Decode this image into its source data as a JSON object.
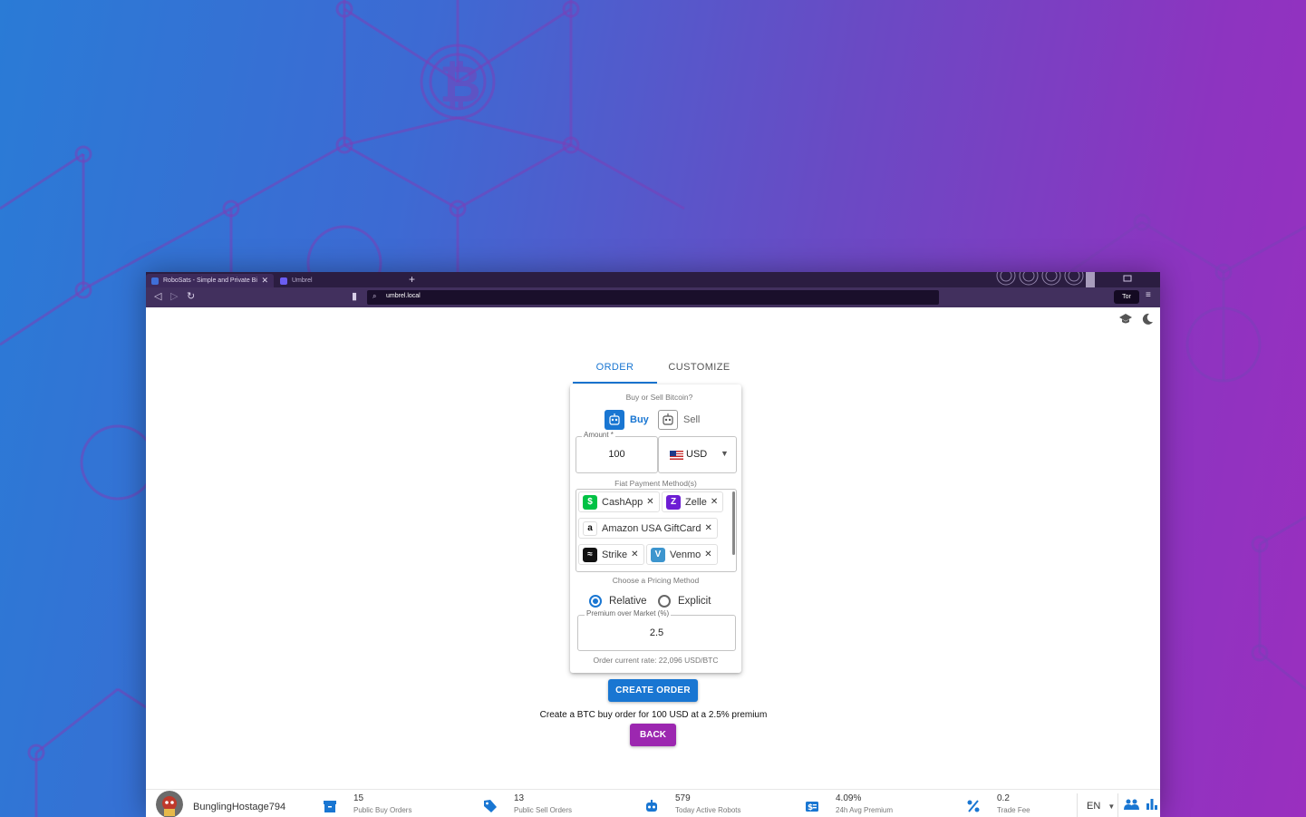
{
  "browser": {
    "tabs": [
      {
        "title": "RoboSats - Simple and Private Bi"
      },
      {
        "title": "Umbrel"
      }
    ],
    "url": "umbrel.local",
    "tor_label": "Tor"
  },
  "app": {
    "tabs": {
      "order": "ORDER",
      "customize": "CUSTOMIZE"
    },
    "form": {
      "buy_sell_label": "Buy or Sell Bitcoin?",
      "buy_label": "Buy",
      "sell_label": "Sell",
      "amount_label": "Amount *",
      "amount_value": "100",
      "currency_value": "USD",
      "payment_label": "Fiat Payment Method(s)",
      "payment_methods": [
        "CashApp",
        "Zelle",
        "Amazon USA GiftCard",
        "Strike",
        "Venmo"
      ],
      "pricing_label": "Choose a Pricing Method",
      "pricing_options": [
        "Relative",
        "Explicit"
      ],
      "pricing_selected": "Relative",
      "premium_label": "Premium over Market (%)",
      "premium_value": "2.5",
      "rate_text": "Order current rate: 22,096 USD/BTC"
    },
    "create_button": "CREATE ORDER",
    "summary_text": "Create a BTC buy order for 100 USD at a 2.5% premium",
    "back_button": "BACK"
  },
  "bottom_bar": {
    "nickname": "BunglingHostage794",
    "stats": [
      {
        "value": "15",
        "label": "Public Buy Orders",
        "icon": "inventory-icon"
      },
      {
        "value": "13",
        "label": "Public Sell Orders",
        "icon": "sell-tag-icon"
      },
      {
        "value": "579",
        "label": "Today Active Robots",
        "icon": "robot-icon"
      },
      {
        "value": "4.09%",
        "label": "24h Avg Premium",
        "icon": "price-change-icon"
      },
      {
        "value": "0.2",
        "label": "Trade Fee",
        "icon": "percent-icon"
      }
    ],
    "language": "EN"
  },
  "colors": {
    "primary": "#1976d2",
    "secondary": "#9c27b0"
  }
}
